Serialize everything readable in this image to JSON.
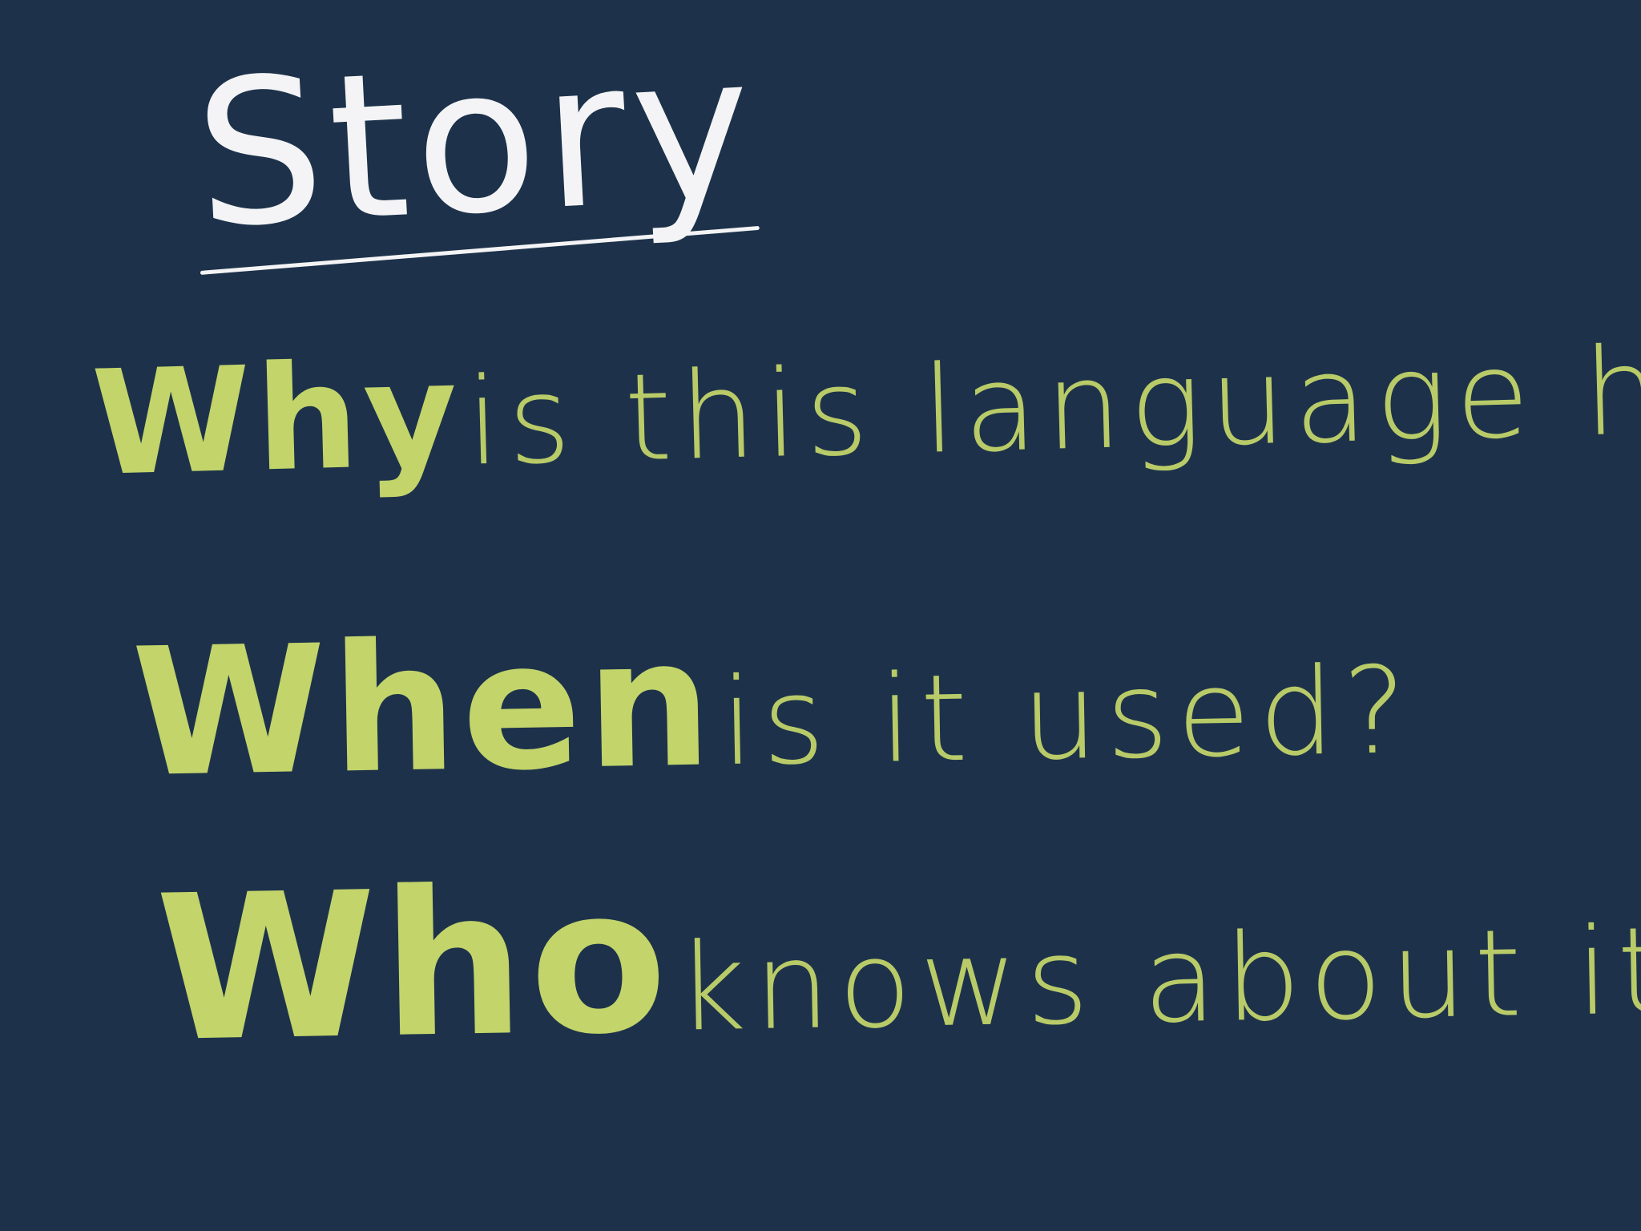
{
  "title": "Story",
  "questions": [
    {
      "word": "Why",
      "rest": "is this language here?"
    },
    {
      "word": "When",
      "rest": "is it used?"
    },
    {
      "word": "Who",
      "rest": "knows about it?"
    }
  ],
  "colors": {
    "background": "#1d324a",
    "title": "#f4f4f6",
    "questions": "#c2d46a"
  }
}
